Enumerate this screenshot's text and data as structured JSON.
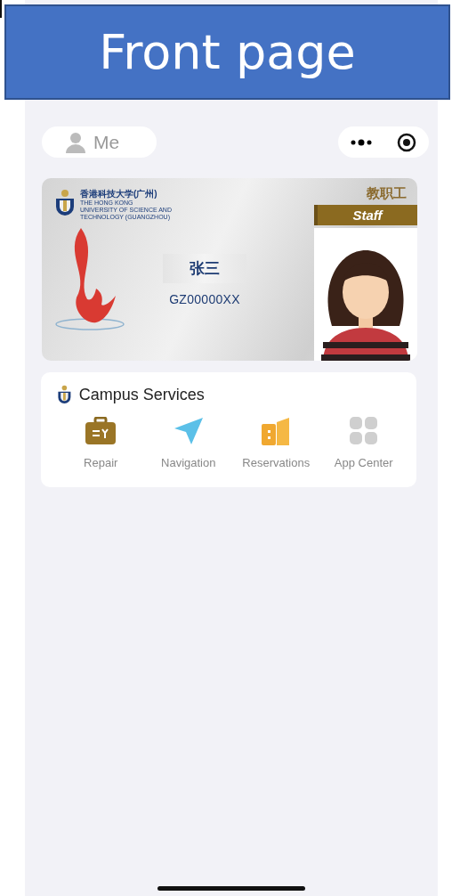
{
  "banner": {
    "title": "Front page"
  },
  "nav": {
    "profile_label": "Me"
  },
  "id_card": {
    "university_zh": "香港科技大学(广州)",
    "university_en": [
      "THE HONG KONG",
      "UNIVERSITY OF SCIENCE AND",
      "TECHNOLOGY (GUANGZHOU)"
    ],
    "role_zh": "教职工",
    "role_en": "Staff",
    "name": "张三",
    "id_number": "GZ00000XX"
  },
  "services": {
    "title": "Campus Services",
    "items": [
      {
        "label": "Repair",
        "kind": "repair"
      },
      {
        "label": "Navigation",
        "kind": "navigation"
      },
      {
        "label": "Reservations",
        "kind": "reservations"
      },
      {
        "label": "App Center",
        "kind": "apps"
      }
    ]
  }
}
